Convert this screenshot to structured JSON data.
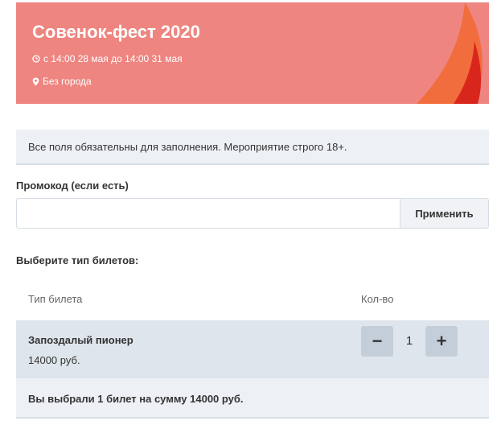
{
  "event": {
    "title": "Совенок-фест 2020",
    "date": "с 14:00 28 мая до 14:00 31 мая",
    "city": "Без города"
  },
  "notice": "Все поля обязательны для заполнения. Мероприятие строго 18+.",
  "promo": {
    "label": "Промокод (если есть)",
    "value": "",
    "placeholder": "",
    "button_label": "Применить"
  },
  "tickets": {
    "heading": "Выберите тип билетов:",
    "columns": {
      "type": "Тип билета",
      "qty": "Кол-во"
    },
    "rows": [
      {
        "name": "Запоздалый пионер",
        "price": "14000 руб.",
        "minus": "−",
        "quantity": "1",
        "plus": "+"
      }
    ],
    "summary": "Вы выбрали 1 билет на сумму 14000 руб."
  },
  "colors": {
    "banner": "#ee8580",
    "flame_outer": "#f26d3d",
    "flame_inner": "#d9261c",
    "row_bg": "#dfe5ec",
    "notice_bg": "#edf1f5"
  }
}
